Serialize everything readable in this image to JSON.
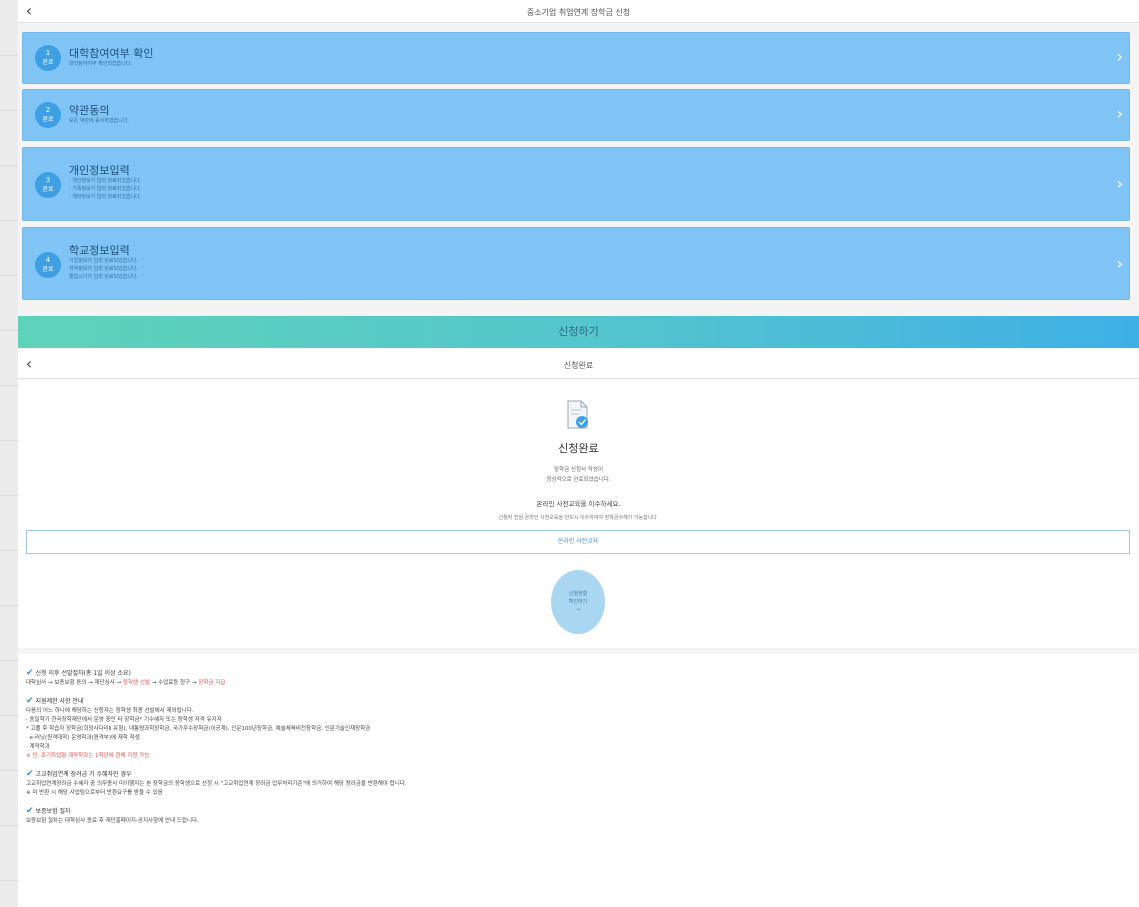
{
  "top_header": {
    "title": "중소기업 취업연계 장학금 신청"
  },
  "steps": [
    {
      "num": "1",
      "badge": "완료",
      "title": "대학참여여부 확인",
      "sub": [
        "대학참여여부 확인되었습니다."
      ]
    },
    {
      "num": "2",
      "badge": "완료",
      "title": "약관동의",
      "sub": [
        "모든 약관에 동의하였습니다."
      ]
    },
    {
      "num": "3",
      "badge": "완료",
      "title": "개인정보입력",
      "sub": [
        "· 개인정보가 입력 완료되었습니다.",
        "· 가족정보가 입력 완료되었습니다.",
        "· 계좌정보가 입력 완료되었습니다."
      ]
    },
    {
      "num": "4",
      "badge": "완료",
      "title": "학교정보입력",
      "sub": [
        "기업정보가 입력 완료되었습니다.",
        "학적정보가 입력 완료되었습니다.",
        "졸업시기가 입력 완료되었습니다."
      ]
    }
  ],
  "apply_button": "신청하기",
  "second_header": {
    "title": "신청완료"
  },
  "complete": {
    "title": "신청완료",
    "desc1": "장학금 신청서 작성이",
    "desc2": "정상적으로 완료되었습니다.",
    "notice": "온라인 사전교육을 이수하세요.",
    "notice_sub": "신청자 전원 온라인 사전교육을 반드시 이수하여야 장학금수혜가 가능합니다.",
    "edu_button": "온라인 사전교육",
    "circle_line1": "신청현황",
    "circle_line2": "확인하기",
    "circle_arrow": "→"
  },
  "notices": {
    "s1_title": "신청 이후 선발절차(총 1일 이상 소요)",
    "s1_a": "대학심사 → 보증보험 동의 → 재단심사 → ",
    "s1_b": "장학생 선발",
    "s1_c": " → 수업료등 청구 → ",
    "s1_d": "장학금 지급",
    "s2_title": "지원제한 사항 안내",
    "s2_l1": "다음의 어느 하나에 해당하는 신청자는 장학생 최종 선발에서 제외됩니다.",
    "s2_l2": "· 동일학기 한국장학재단에서 운영 중인 타 장학금* 기수혜자 또는 장학생 자격 유지자",
    "s2_l3": "* 고졸 후 학습자 장학금(희망사다리Ⅱ 유형), 대통령과학장학금, 국가우수장학금(이공계), 인문100년장학금, 예술체육비전장학금, 인문기술인재장학금",
    "s2_l4": "· e-러닝(원격대학) 운영학과(원격부)에 재학 학생",
    "s2_l5": "· 계약학과",
    "s2_l6": "※ 단, 조기취업형 계약학과는 1학년에 한해 지원 가능",
    "s3_title": "고교취업연계 장려금 기 수혜자인 경우",
    "s3_l1": "고교취업연계장려금 수혜자 중 의무종사 미이행자는 본 장학금의 장학생으로 선정 시 \"고교취업연계 장려금 업무처리기준\"에 의거하여 해당 장려금을 반환해야 합니다.",
    "s3_l2": "※ 미 반환 시 해당 사업팀으로부터 반환요구를 받을 수 있음",
    "s4_title": "보증보험 절차",
    "s4_l1": "보증보험 절차는 대학심사 종료 후 재단홈페이지-공지사항에 안내 드립니다."
  },
  "colors": {
    "card": "#7fc4f5",
    "icon": "#3f9fe3",
    "gradient_start": "#5fd3b9",
    "gradient_end": "#3eb0e6",
    "red": "#e84f4f",
    "check": "#3b8fd9"
  }
}
